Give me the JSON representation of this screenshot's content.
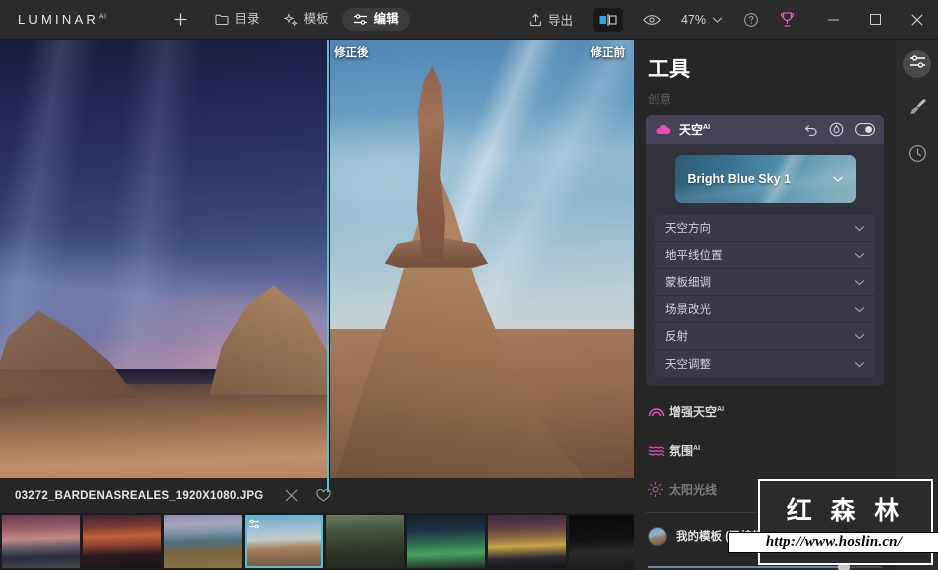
{
  "app": {
    "brand": "LUMINAR",
    "brand_sup": "AI"
  },
  "topbar": {
    "add_label": "+",
    "nav": [
      {
        "label": "目录",
        "icon": "folder-icon",
        "active": false
      },
      {
        "label": "模板",
        "icon": "sparkle-icon",
        "active": false
      },
      {
        "label": "编辑",
        "icon": "sliders-icon",
        "active": true
      }
    ],
    "export_label": "导出",
    "compare_icon": "split-compare-icon",
    "preview_icon": "eye-icon",
    "zoom_value": "47%",
    "help_icon": "help-circle-icon",
    "trophy_icon": "trophy-icon",
    "trophy_color": "#e060b4",
    "window": {
      "minimize": "–",
      "maximize": "□",
      "close": "✕"
    }
  },
  "canvas": {
    "before_label": "修正前",
    "after_label": "修正後",
    "split_color": "#4ec3d9"
  },
  "infobar": {
    "filename": "03272_BARDENASREALES_1920X1080.JPG",
    "close_icon": "close-icon",
    "favorite_icon": "heart-icon"
  },
  "filmstrip": {
    "selected_index": 3,
    "thumbs": [
      {
        "name": "pier-sunset-thumb",
        "selected": false
      },
      {
        "name": "city-sunset-thumb",
        "selected": false
      },
      {
        "name": "coast-rocks-thumb",
        "selected": false
      },
      {
        "name": "bardenas-reales-thumb",
        "selected": true,
        "badge": "edited-badge"
      },
      {
        "name": "desert-shrubs-thumb",
        "selected": false
      },
      {
        "name": "green-harbor-night-thumb",
        "selected": false
      },
      {
        "name": "coastal-road-night-thumb",
        "selected": false
      },
      {
        "name": "city-skyline-bw-thumb",
        "selected": false
      },
      {
        "name": "city-dusk-thumb",
        "selected": false
      }
    ]
  },
  "tools": {
    "title": "工具",
    "section_label": "创意",
    "sky": {
      "name": "天空",
      "ai_tag": "AI",
      "icon": "cloud-icon",
      "icon_color": "#e84fb8",
      "reset_icon": "undo-icon",
      "mask_icon": "mask-brush-icon",
      "toggle_icon": "toggle-on-icon",
      "preset_name": "Bright Blue Sky 1",
      "preset_chevron": "chevron-down-icon",
      "subsections": [
        {
          "label": "天空方向",
          "chevron": "chevron-down-icon"
        },
        {
          "label": "地平线位置",
          "chevron": "chevron-down-icon"
        },
        {
          "label": "蒙板细调",
          "chevron": "chevron-down-icon"
        },
        {
          "label": "场景改光",
          "chevron": "chevron-down-icon"
        },
        {
          "label": "反射",
          "chevron": "chevron-down-icon"
        },
        {
          "label": "天空调整",
          "chevron": "chevron-down-icon"
        }
      ]
    },
    "list": [
      {
        "label": "增强天空",
        "ai_tag": "AI",
        "icon": "sky-enhancer-icon",
        "icon_color": "#e84fb8",
        "dim": false
      },
      {
        "label": "氛围",
        "ai_tag": "AI",
        "icon": "atmosphere-icon",
        "icon_color": "#e84fb8",
        "dim": false
      },
      {
        "label": "太阳光线",
        "ai_tag": "",
        "icon": "sunrays-icon",
        "icon_color": "#8f5f86",
        "dim": true
      }
    ],
    "template": {
      "label": "我的模板 (已编辑)",
      "avatar": "template-avatar",
      "slider_value": 83
    }
  },
  "rail": {
    "items": [
      {
        "icon": "adjustments-icon",
        "active": true
      },
      {
        "icon": "brush-icon",
        "active": false
      },
      {
        "icon": "history-clock-icon",
        "active": false
      }
    ]
  },
  "watermark": {
    "title": "红 森 林",
    "url": "http://www.hoslin.cn/"
  }
}
